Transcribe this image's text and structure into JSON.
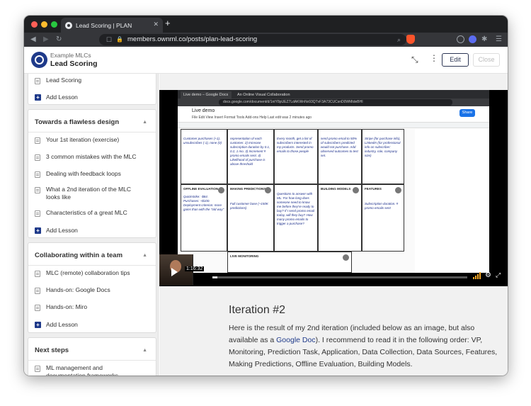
{
  "browser": {
    "tab_title": "Lead Scoring | PLAN",
    "url": "members.ownml.co/posts/plan-lead-scoring"
  },
  "header": {
    "org": "Example MLCs",
    "course": "Lead Scoring",
    "edit_label": "Edit",
    "close_label": "Close"
  },
  "sidebar": {
    "top": {
      "lessons": [
        "Lead Scoring"
      ],
      "add_label": "Add Lesson"
    },
    "sections": [
      {
        "title": "Towards a flawless design",
        "lessons": [
          "Your 1st iteration (exercise)",
          "3 common mistakes with the MLC",
          "Dealing with feedback loops",
          "What a 2nd iteration of the MLC looks like",
          "Characteristics of a great MLC"
        ],
        "add_label": "Add Lesson"
      },
      {
        "title": "Collaborating within a team",
        "lessons": [
          "MLC (remote) collaboration tips",
          "Hands-on: Google Docs",
          "Hands-on: Miro"
        ],
        "add_label": "Add Lesson"
      },
      {
        "title": "Next steps",
        "lessons": [
          "ML management and documentation frameworks"
        ]
      }
    ]
  },
  "video": {
    "timecode": "1:16:32",
    "progress": 0.02,
    "doc_title": "Live demo",
    "doc_tabs": [
      "Live demo – Google Docs",
      "An Online Visual Collaboration Pla..."
    ],
    "doc_url": "docs.google.com/document/d/1ntY8pUEZ7LdAKWnNv93QTvF3A73CUCsnD0WMtdeBHI",
    "doc_menu": "File  Edit  View  Insert  Format  Tools  Add-ons  Help   Last edit was 2 minutes ago",
    "share_label": "Share",
    "cells": [
      {
        "h": "",
        "t": "Customer purchases (+1), unsubscribes (-1), none (0)"
      },
      {
        "h": "",
        "t": "representation of each customer. 2) Increase subscription duration by 0.1, 0.2, 1 mo. 3) Increment # promo emails sent. 4) Likelihood of purchase is above threshold"
      },
      {
        "h": "",
        "t": "Every month, get a list of subscribers interested in my products. Send promo emails to those people"
      },
      {
        "h": "",
        "t": "send promo email to 50% of subscribers predicted would not purchase. Add observed outcomes to test set."
      },
      {
        "h": "",
        "t": "Stripe (for purchase info), LinkedIn (for professional info on subscriber: industry, role, company size)"
      },
      {
        "h": "OFFLINE EVALUATION",
        "t": "Quickstrike: -$84. Purchases: +$100. Deployment criterion: more gains than with the \"old way\""
      },
      {
        "h": "MAKING PREDICTIONS",
        "t": "Full customer base (~150K predictions)"
      },
      {
        "h": "",
        "t": "Questions to answer with ML: For how long does someone need to know me before they're ready to buy? If I send promo email today, will they buy? How many promo emails to trigger a purchase?"
      },
      {
        "h": "BUILDING MODELS",
        "t": ""
      },
      {
        "h": "FEATURES",
        "t": "Subscription duration. # promo emails sent"
      },
      {
        "h": "LIVE MONITORING",
        "t": ""
      }
    ]
  },
  "article": {
    "heading": "Iteration #2",
    "para_before": "Here is the result of my 2nd iteration (included below as an image, but also available as a ",
    "link": "Google Doc",
    "para_after": "). I recommend to read it in the following order: VP, Monitoring, Prediction Task, Application, Data Collection, Data Sources, Features, Making Predictions, Offline Evaluation, Building Models."
  }
}
